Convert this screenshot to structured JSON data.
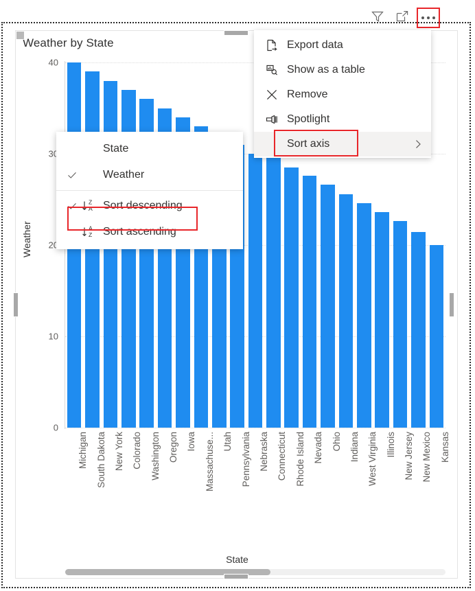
{
  "visual": {
    "title": "Weather by State",
    "y_axis_title": "Weather",
    "x_axis_title": "State"
  },
  "toolbar": {
    "filter_icon": "filter-icon",
    "focus_icon": "focus-mode-icon",
    "more_options_icon": "more-options-icon",
    "highlight_color": "#e8262a"
  },
  "context_menu": {
    "items": [
      {
        "label": "Export data",
        "icon": "export-data-icon",
        "active": false,
        "has_submenu": false
      },
      {
        "label": "Show as a table",
        "icon": "show-as-table-icon",
        "active": false,
        "has_submenu": false
      },
      {
        "label": "Remove",
        "icon": "remove-icon",
        "active": false,
        "has_submenu": false
      },
      {
        "label": "Spotlight",
        "icon": "spotlight-icon",
        "active": false,
        "has_submenu": false
      },
      {
        "label": "Sort axis",
        "icon": "",
        "active": true,
        "has_submenu": true
      }
    ]
  },
  "sort_submenu": {
    "items": [
      {
        "label": "State",
        "checked": false,
        "sort_icon": ""
      },
      {
        "label": "Weather",
        "checked": true,
        "sort_icon": ""
      },
      {
        "label": "Sort descending",
        "checked": true,
        "sort_icon": "sort-descending-icon"
      },
      {
        "label": "Sort ascending",
        "checked": false,
        "sort_icon": "sort-ascending-icon"
      }
    ],
    "highlighted_item": "Sort ascending"
  },
  "scrollbar": {
    "orientation": "horizontal",
    "thumb_fraction": 0.54
  },
  "chart_data": {
    "type": "bar",
    "title": "Weather by State",
    "xlabel": "State",
    "ylabel": "Weather",
    "ylim": [
      0,
      40
    ],
    "yticks": [
      0,
      10,
      20,
      30,
      40
    ],
    "grid": true,
    "legend": "none",
    "bar_color": "#1f8cf0",
    "sort_order": "descending",
    "categories": [
      "Michigan",
      "South Dakota",
      "New York",
      "Colorado",
      "Washington",
      "Oregon",
      "Iowa",
      "Massachuse...",
      "Utah",
      "Pennsylvania",
      "Nebraska",
      "Connecticut",
      "Rhode Island",
      "Nevada",
      "Ohio",
      "Indiana",
      "West Virginia",
      "Illinois",
      "New Jersey",
      "New Mexico",
      "Kansas"
    ],
    "values": [
      40,
      39,
      38,
      37,
      36,
      35,
      34,
      33,
      32,
      31,
      30,
      29.7,
      28.5,
      27.6,
      26.6,
      25.6,
      24.6,
      23.6,
      22.6,
      21.4,
      20
    ]
  }
}
